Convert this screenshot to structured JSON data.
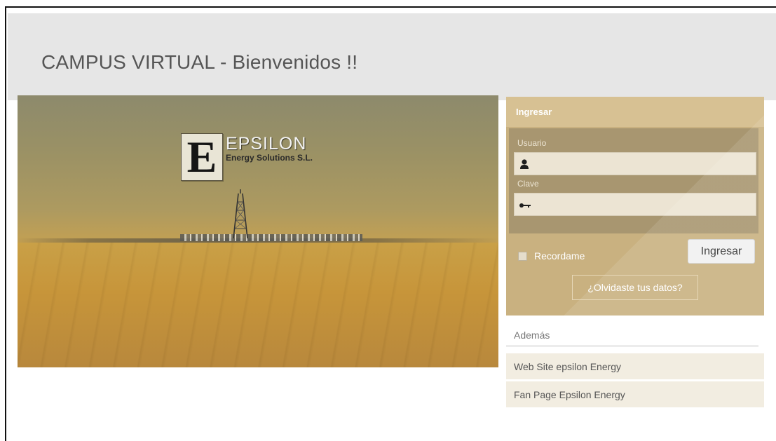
{
  "header": {
    "title": "CAMPUS VIRTUAL - Bienvenidos !!"
  },
  "hero": {
    "logo_letter": "E",
    "logo_name": "EPSILON",
    "logo_subtitle": "Energy Solutions S.L."
  },
  "login": {
    "title": "Ingresar",
    "username_label": "Usuario",
    "username_value": "",
    "password_label": "Clave",
    "password_value": "",
    "remember_label": "Recordame",
    "remember_checked": false,
    "submit_label": "Ingresar",
    "forgot_label": "¿Olvidaste tus datos?",
    "user_icon": "user-icon",
    "key_icon": "key-icon"
  },
  "extras": {
    "heading": "Además",
    "links": [
      {
        "label": "Web Site epsilon Energy"
      },
      {
        "label": "Fan Page Epsilon Energy"
      }
    ]
  },
  "colors": {
    "header_bg": "#e6e6e6",
    "login_panel": "#c9b180",
    "login_title_bar": "#d7c193",
    "login_fields_bg": "#a89670",
    "link_bg": "#f2ede1"
  }
}
